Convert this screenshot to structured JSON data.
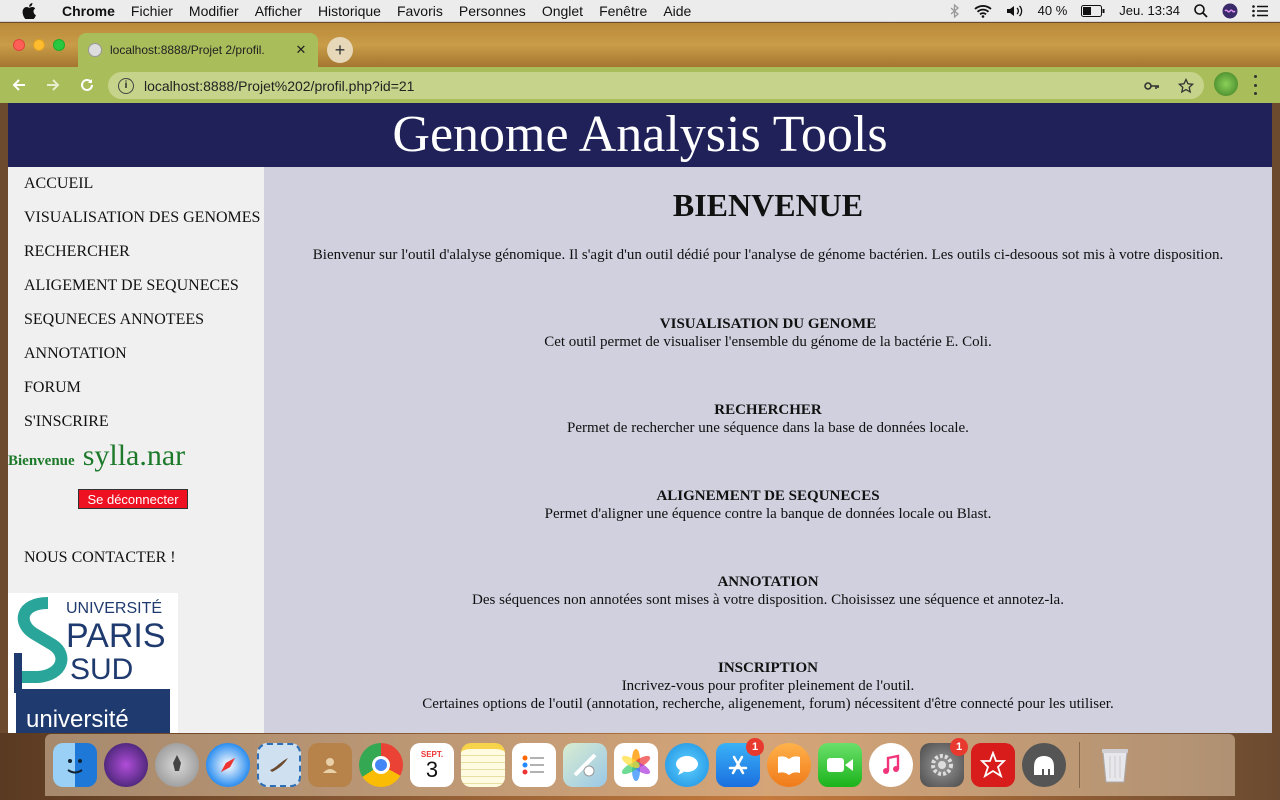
{
  "menubar": {
    "app_name": "Chrome",
    "menus": [
      "Fichier",
      "Modifier",
      "Afficher",
      "Historique",
      "Favoris",
      "Personnes",
      "Onglet",
      "Fenêtre",
      "Aide"
    ],
    "battery": "40 %",
    "clock": "Jeu. 13:34"
  },
  "browser": {
    "tab_title": "localhost:8888/Projet 2/profil.",
    "url": "localhost:8888/Projet%202/profil.php?id=21"
  },
  "site": {
    "header_title": "Genome Analysis Tools",
    "nav": [
      "ACCUEIL",
      "VISUALISATION DES GENOMES",
      "RECHERCHER",
      "ALIGEMENT DE SEQUNECES",
      "SEQUNECES ANNOTEES",
      "ANNOTATION",
      "FORUM",
      "S'INSCRIRE"
    ],
    "welcome_label": "Bienvenue",
    "username": "sylla.nar",
    "logout_label": "Se déconnecter",
    "contact_label": "NOUS CONTACTER !",
    "logo": {
      "line1": "UNIVERSITÉ",
      "line2": "PARIS",
      "line3": "SUD",
      "line4": "université"
    }
  },
  "main": {
    "heading": "BIENVENUE",
    "intro": "Bienvenur sur l'outil d'alalyse génomique. Il s'agit d'un outil dédié pour l'analyse de génome bactérien. Les outils ci-desoous sot mis à votre disposition.",
    "sections": [
      {
        "title": "VISUALISATION DU GENOME",
        "lines": [
          "Cet outil permet de visualiser l'ensemble du génome de la bactérie E. Coli."
        ]
      },
      {
        "title": "RECHERCHER",
        "lines": [
          "Permet de rechercher une séquence dans la base de données locale."
        ]
      },
      {
        "title": "ALIGNEMENT DE SEQUNECES",
        "lines": [
          "Permet d'aligner une équence contre la banque de données locale ou Blast."
        ]
      },
      {
        "title": "ANNOTATION",
        "lines": [
          "Des séquences non annotées sont mises à votre disposition. Choisissez une séquence et annotez-la."
        ]
      },
      {
        "title": "INSCRIPTION",
        "lines": [
          "Incrivez-vous pour profiter pleinement de l'outil.",
          "Certaines options de l'outil (annotation, recherche, aligenement, forum) nécessitent d'être connecté pour les utiliser."
        ]
      }
    ]
  },
  "dock": {
    "calendar_month": "SEPT.",
    "calendar_day": "3",
    "app_store_badge": "1",
    "settings_badge": "1"
  }
}
